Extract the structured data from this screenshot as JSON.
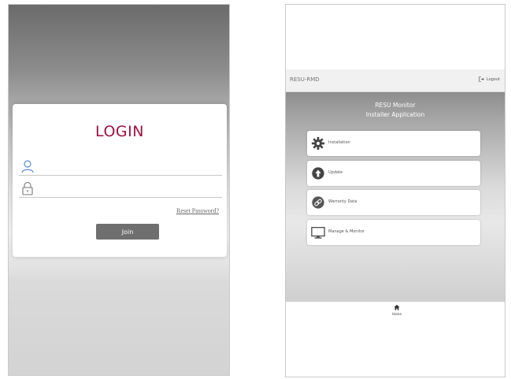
{
  "login_screen": {
    "title": "LOGIN",
    "username_field": {
      "value": "",
      "placeholder": "",
      "icon": "user-icon"
    },
    "password_field": {
      "value": "",
      "placeholder": "",
      "icon": "lock-icon"
    },
    "reset_link": "Reset Password?",
    "join_button": "Join",
    "colors": {
      "title": "#a50f3d",
      "button": "#6f6f6f"
    }
  },
  "menu_screen": {
    "app_bar": {
      "title": "RESU-RMD",
      "logout_label": "Logout",
      "logout_icon": "logout-icon"
    },
    "hero": {
      "line1": "RESU Monitor",
      "line2": "Installer Application"
    },
    "items": [
      {
        "label": "Installation",
        "icon": "gear-icon"
      },
      {
        "label": "Update",
        "icon": "upload-arrow-icon"
      },
      {
        "label": "Warranty Data",
        "icon": "link-icon"
      },
      {
        "label": "Manage & Monitor",
        "icon": "monitor-icon"
      }
    ],
    "bottom_nav": {
      "home_label": "Home",
      "home_icon": "home-icon"
    }
  }
}
